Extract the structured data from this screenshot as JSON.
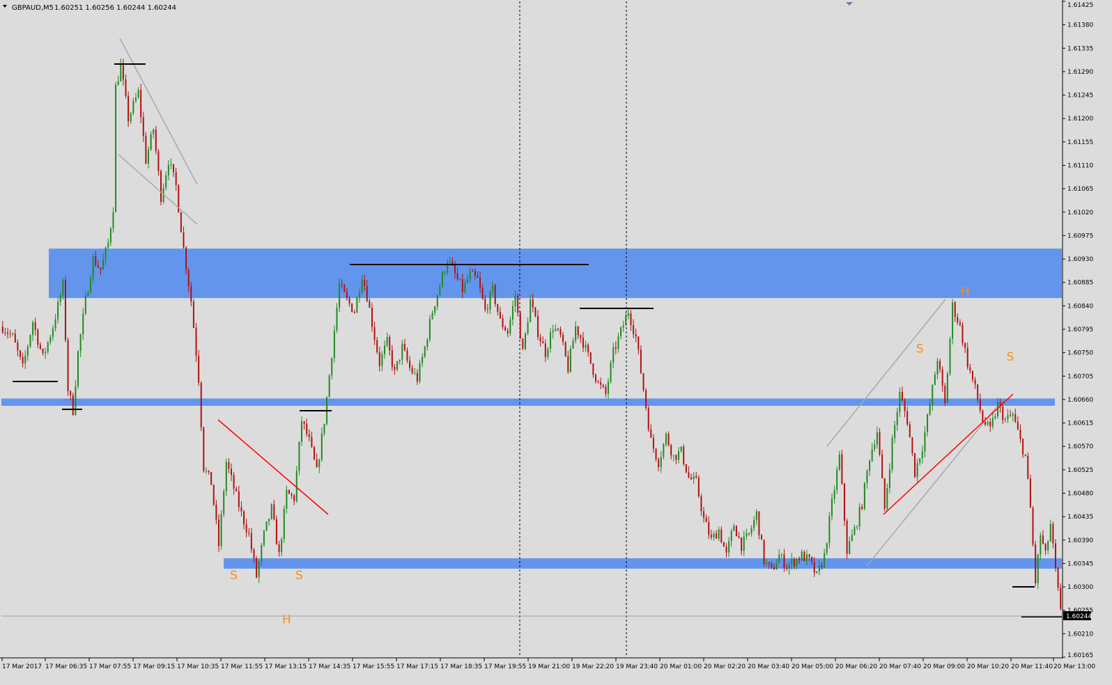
{
  "header": {
    "symbol_line": "GBPAUD,M5",
    "ohlc": "1.60251 1.60256 1.60244 1.60244"
  },
  "colors": {
    "background": "#dcdcdc",
    "bull_candle": "#1f8a1f",
    "bear_candle": "#b01010",
    "zone": "#6495ed",
    "trendline": "#ff0000",
    "channel": "#a8a8a8",
    "level": "#000000",
    "pattern_label": "#ff8c1a"
  },
  "chart_data": {
    "type": "candlestick",
    "timeframe": "M5",
    "ylim": [
      1.60165,
      1.61425
    ],
    "y_ticks": [
      "1.61425",
      "1.61380",
      "1.61335",
      "1.61290",
      "1.61245",
      "1.61200",
      "1.61155",
      "1.61110",
      "1.61065",
      "1.61020",
      "1.60975",
      "1.60930",
      "1.60885",
      "1.60840",
      "1.60795",
      "1.60750",
      "1.60705",
      "1.60660",
      "1.60615",
      "1.60570",
      "1.60525",
      "1.60480",
      "1.60435",
      "1.60390",
      "1.60345",
      "1.60300",
      "1.60255",
      "1.60210",
      "1.60165"
    ],
    "x_ticks": [
      "17 Mar 2017",
      "17 Mar 06:35",
      "17 Mar 07:55",
      "17 Mar 09:15",
      "17 Mar 10:35",
      "17 Mar 11:55",
      "17 Mar 13:15",
      "17 Mar 14:35",
      "17 Mar 15:55",
      "17 Mar 17:15",
      "17 Mar 18:35",
      "17 Mar 19:55",
      "19 Mar 21:00",
      "19 Mar 22:20",
      "19 Mar 23:40",
      "20 Mar 01:00",
      "20 Mar 02:20",
      "20 Mar 03:40",
      "20 Mar 05:00",
      "20 Mar 06:20",
      "20 Mar 07:40",
      "20 Mar 09:00",
      "20 Mar 10:20",
      "20 Mar 11:40",
      "20 Mar 13:00"
    ],
    "current_price": "1.60244",
    "price_path": [
      [
        0,
        1.608
      ],
      [
        4,
        1.6078
      ],
      [
        8,
        1.6072
      ],
      [
        12,
        1.6081
      ],
      [
        16,
        1.6074
      ],
      [
        20,
        1.608
      ],
      [
        24,
        1.6088
      ],
      [
        26,
        1.6068
      ],
      [
        28,
        1.6064
      ],
      [
        30,
        1.6075
      ],
      [
        33,
        1.6085
      ],
      [
        36,
        1.6093
      ],
      [
        39,
        1.6091
      ],
      [
        42,
        1.6096
      ],
      [
        44,
        1.6103
      ],
      [
        45,
        1.6126
      ],
      [
        47,
        1.613
      ],
      [
        50,
        1.612
      ],
      [
        54,
        1.6125
      ],
      [
        57,
        1.6112
      ],
      [
        60,
        1.6118
      ],
      [
        63,
        1.6105
      ],
      [
        66,
        1.6112
      ],
      [
        69,
        1.6107
      ],
      [
        72,
        1.6095
      ],
      [
        75,
        1.6085
      ],
      [
        78,
        1.607
      ],
      [
        80,
        1.6053
      ],
      [
        83,
        1.605
      ],
      [
        86,
        1.6038
      ],
      [
        89,
        1.6054
      ],
      [
        92,
        1.6049
      ],
      [
        95,
        1.6044
      ],
      [
        98,
        1.604
      ],
      [
        101,
        1.6032
      ],
      [
        104,
        1.604
      ],
      [
        107,
        1.6045
      ],
      [
        110,
        1.6036
      ],
      [
        113,
        1.6048
      ],
      [
        116,
        1.6047
      ],
      [
        119,
        1.6062
      ],
      [
        122,
        1.6058
      ],
      [
        125,
        1.6052
      ],
      [
        128,
        1.6062
      ],
      [
        131,
        1.6075
      ],
      [
        134,
        1.6088
      ],
      [
        137,
        1.6085
      ],
      [
        140,
        1.6083
      ],
      [
        143,
        1.609
      ],
      [
        145,
        1.6086
      ],
      [
        148,
        1.6078
      ],
      [
        150,
        1.6073
      ],
      [
        153,
        1.6077
      ],
      [
        156,
        1.6071
      ],
      [
        159,
        1.6076
      ],
      [
        162,
        1.6072
      ],
      [
        165,
        1.607
      ],
      [
        168,
        1.6076
      ],
      [
        171,
        1.6083
      ],
      [
        174,
        1.6088
      ],
      [
        177,
        1.6093
      ],
      [
        180,
        1.609
      ],
      [
        183,
        1.6087
      ],
      [
        186,
        1.609
      ],
      [
        189,
        1.6089
      ],
      [
        192,
        1.6083
      ],
      [
        195,
        1.6087
      ],
      [
        198,
        1.6081
      ],
      [
        201,
        1.6079
      ],
      [
        204,
        1.6086
      ],
      [
        207,
        1.6075
      ],
      [
        210,
        1.6085
      ],
      [
        213,
        1.6079
      ],
      [
        216,
        1.6075
      ],
      [
        219,
        1.608
      ],
      [
        222,
        1.6078
      ],
      [
        225,
        1.6072
      ],
      [
        228,
        1.608
      ],
      [
        231,
        1.6077
      ],
      [
        234,
        1.6073
      ],
      [
        237,
        1.6069
      ],
      [
        240,
        1.6067
      ],
      [
        243,
        1.6075
      ],
      [
        246,
        1.6079
      ],
      [
        249,
        1.6083
      ],
      [
        252,
        1.6078
      ],
      [
        255,
        1.6068
      ],
      [
        258,
        1.6058
      ],
      [
        261,
        1.6054
      ],
      [
        264,
        1.6059
      ],
      [
        267,
        1.6055
      ],
      [
        270,
        1.6056
      ],
      [
        273,
        1.6051
      ],
      [
        276,
        1.605
      ],
      [
        279,
        1.6043
      ],
      [
        282,
        1.6039
      ],
      [
        285,
        1.6041
      ],
      [
        288,
        1.6036
      ],
      [
        291,
        1.6042
      ],
      [
        294,
        1.6038
      ],
      [
        297,
        1.604
      ],
      [
        300,
        1.6044
      ],
      [
        303,
        1.6035
      ],
      [
        306,
        1.6033
      ],
      [
        309,
        1.6036
      ],
      [
        312,
        1.6034
      ],
      [
        315,
        1.6035
      ],
      [
        318,
        1.6036
      ],
      [
        321,
        1.6035
      ],
      [
        324,
        1.6032
      ],
      [
        327,
        1.6036
      ],
      [
        330,
        1.6046
      ],
      [
        333,
        1.6055
      ],
      [
        336,
        1.6037
      ],
      [
        339,
        1.6041
      ],
      [
        342,
        1.6046
      ],
      [
        345,
        1.6055
      ],
      [
        348,
        1.606
      ],
      [
        351,
        1.6045
      ],
      [
        354,
        1.6058
      ],
      [
        357,
        1.6067
      ],
      [
        360,
        1.6062
      ],
      [
        363,
        1.6052
      ],
      [
        366,
        1.6057
      ],
      [
        369,
        1.6065
      ],
      [
        372,
        1.6074
      ],
      [
        375,
        1.6065
      ],
      [
        378,
        1.6084
      ],
      [
        381,
        1.608
      ],
      [
        384,
        1.6073
      ],
      [
        387,
        1.6068
      ],
      [
        390,
        1.6062
      ],
      [
        393,
        1.606
      ],
      [
        396,
        1.6065
      ],
      [
        399,
        1.6062
      ],
      [
        402,
        1.6063
      ],
      [
        405,
        1.6058
      ],
      [
        407,
        1.6055
      ],
      [
        409,
        1.6045
      ],
      [
        411,
        1.6031
      ],
      [
        413,
        1.604
      ],
      [
        415,
        1.6036
      ],
      [
        417,
        1.6042
      ],
      [
        419,
        1.6033
      ],
      [
        421,
        1.6025
      ]
    ],
    "zones": [
      {
        "low": 1.60855,
        "high": 1.6095
      },
      {
        "low": 1.60648,
        "high": 1.60662
      },
      {
        "low": 1.60335,
        "high": 1.60355
      }
    ],
    "pattern_labels": [
      {
        "text": "S",
        "x": 92,
        "y": 1.60315
      },
      {
        "text": "H",
        "x": 113,
        "y": 1.6023
      },
      {
        "text": "S",
        "x": 118,
        "y": 1.60315
      },
      {
        "text": "S",
        "x": 365,
        "y": 1.6075
      },
      {
        "text": "H",
        "x": 383,
        "y": 1.6086
      },
      {
        "text": "S",
        "x": 401,
        "y": 1.60735
      }
    ]
  }
}
